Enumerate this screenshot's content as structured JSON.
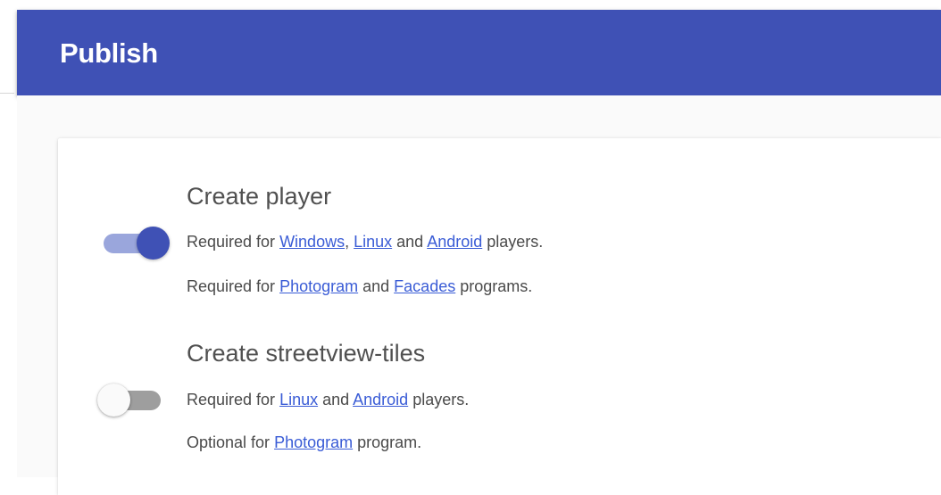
{
  "header": {
    "title": "Publish",
    "color": "#3f51b5"
  },
  "options": [
    {
      "title": "Create player",
      "enabled": true,
      "line1": {
        "prefix": "Required for ",
        "link1": "Windows",
        "sep1": ", ",
        "link2": "Linux",
        "sep2": " and ",
        "link3": "Android",
        "suffix": " players."
      },
      "line2": {
        "prefix": "Required for ",
        "link1": "Photogram",
        "sep1": " and ",
        "link2": "Facades",
        "suffix": " programs."
      }
    },
    {
      "title": "Create streetview-tiles",
      "enabled": false,
      "line1": {
        "prefix": "Required for ",
        "link1": "Linux",
        "sep1": " and ",
        "link2": "Android",
        "suffix": " players."
      },
      "line2": {
        "prefix": "Optional for ",
        "link1": "Photogram",
        "suffix": " program."
      }
    }
  ],
  "colors": {
    "toggle_on_thumb": "#3f51b5",
    "toggle_on_track": "#9aa6dc",
    "toggle_off_track": "#9e9e9e",
    "link": "#3a5cd6"
  }
}
